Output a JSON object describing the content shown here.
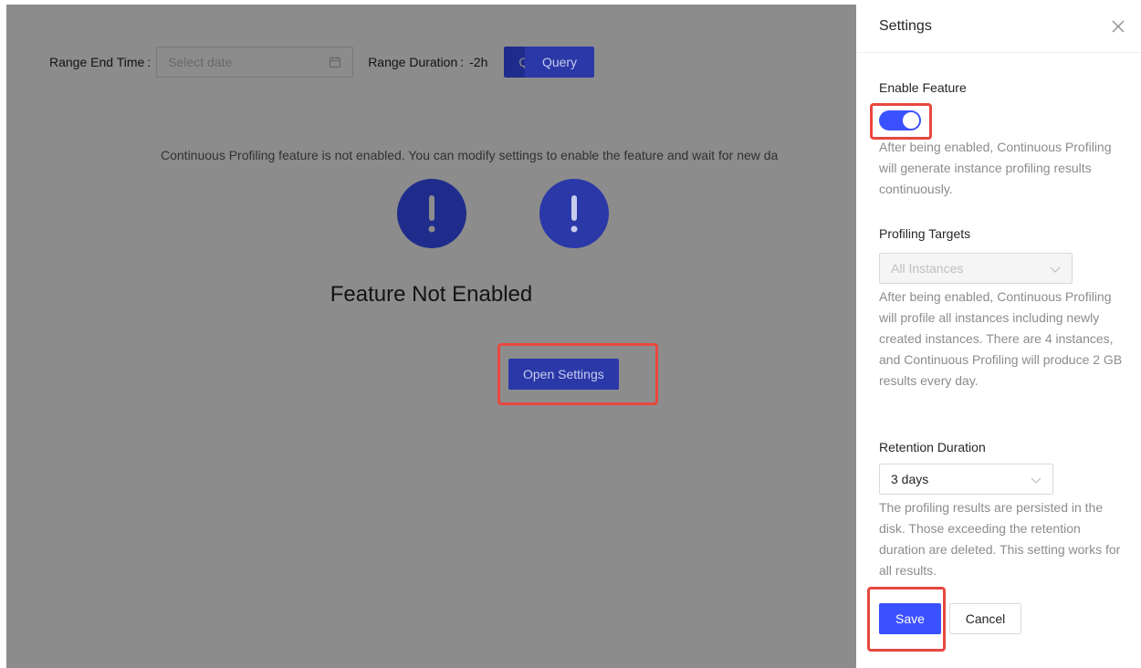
{
  "toolbar": {
    "range_end_label": "Range End Time",
    "colon": ":",
    "date_placeholder": "Select date",
    "range_duration_label": "Range Duration",
    "range_duration_value": "-2h",
    "query_label": "Query"
  },
  "empty_state": {
    "icon": "exclamation-icon",
    "title": "Feature Not Enabled",
    "description": "Continuous Profiling feature is not enabled. You can modify settings to enable the feature and wait for new da",
    "open_settings_label": "Open Settings"
  },
  "drawer": {
    "title": "Settings",
    "enable_feature": {
      "label": "Enable Feature",
      "enabled": true,
      "help": "After being enabled, Continuous Profiling will generate instance profiling results continuously."
    },
    "profiling_targets": {
      "label": "Profiling Targets",
      "selected": "All Instances",
      "help": "After being enabled, Continuous Profiling will profile all instances including newly created instances. There are 4 instances, and Continuous Profiling will produce 2 GB results every day."
    },
    "retention": {
      "label": "Retention Duration",
      "selected": "3 days",
      "help": "The profiling results are persisted in the disk. Those exceeding the retention duration are deleted. This setting works for all results."
    },
    "save_label": "Save",
    "cancel_label": "Cancel"
  },
  "colors": {
    "primary": "#3b51ff",
    "highlight": "#e8473f",
    "mask": "rgba(0,0,0,0.45)"
  }
}
